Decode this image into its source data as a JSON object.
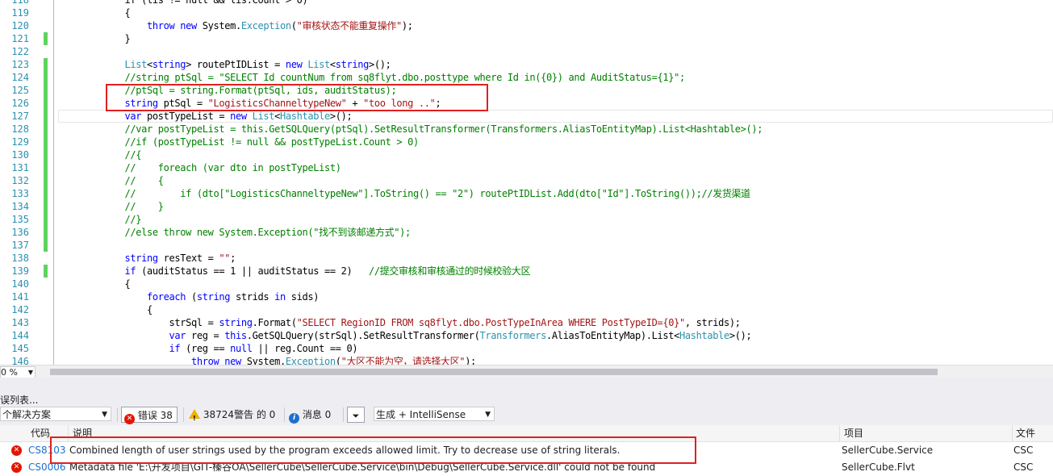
{
  "editor": {
    "lines": [
      {
        "num": "118",
        "indent": "            ",
        "tokens": [
          {
            "t": "if (lis != null && lis.Count > 0)",
            "c": ""
          }
        ]
      },
      {
        "num": "119",
        "indent": "            ",
        "tokens": [
          {
            "t": "{",
            "c": ""
          }
        ]
      },
      {
        "num": "120",
        "indent": "                ",
        "tokens": [
          {
            "t": "throw",
            "c": "kw"
          },
          {
            "t": " ",
            "c": ""
          },
          {
            "t": "new",
            "c": "kw"
          },
          {
            "t": " System.",
            "c": ""
          },
          {
            "t": "Exception",
            "c": "ty"
          },
          {
            "t": "(",
            "c": ""
          },
          {
            "t": "\"审核状态不能重复操作\"",
            "c": "st"
          },
          {
            "t": ");",
            "c": ""
          }
        ]
      },
      {
        "num": "121",
        "indent": "            ",
        "tokens": [
          {
            "t": "}",
            "c": ""
          }
        ]
      },
      {
        "num": "122",
        "indent": "",
        "tokens": []
      },
      {
        "num": "123",
        "indent": "            ",
        "tokens": [
          {
            "t": "List",
            "c": "ty"
          },
          {
            "t": "<",
            "c": ""
          },
          {
            "t": "string",
            "c": "kw"
          },
          {
            "t": "> routePtIDList = ",
            "c": ""
          },
          {
            "t": "new",
            "c": "kw"
          },
          {
            "t": " ",
            "c": ""
          },
          {
            "t": "List",
            "c": "ty"
          },
          {
            "t": "<",
            "c": ""
          },
          {
            "t": "string",
            "c": "kw"
          },
          {
            "t": ">();",
            "c": ""
          }
        ]
      },
      {
        "num": "124",
        "indent": "            ",
        "tokens": [
          {
            "t": "//string ptSql = \"SELECT Id countNum from sq8flyt.dbo.posttype where Id in({0}) and AuditStatus={1}\";",
            "c": "cm"
          }
        ]
      },
      {
        "num": "125",
        "indent": "            ",
        "tokens": [
          {
            "t": "//ptSql = string.Format(ptSql, ids, auditStatus);",
            "c": "cm"
          }
        ]
      },
      {
        "num": "126",
        "indent": "            ",
        "tokens": [
          {
            "t": "string",
            "c": "kw"
          },
          {
            "t": " ptSql = ",
            "c": ""
          },
          {
            "t": "\"LogisticsChanneltypeNew\"",
            "c": "st"
          },
          {
            "t": " + ",
            "c": ""
          },
          {
            "t": "\"too long ..\"",
            "c": "st"
          },
          {
            "t": ";",
            "c": ""
          }
        ]
      },
      {
        "num": "127",
        "indent": "            ",
        "tokens": [
          {
            "t": "var",
            "c": "kw"
          },
          {
            "t": " postTypeList = ",
            "c": ""
          },
          {
            "t": "new",
            "c": "kw"
          },
          {
            "t": " ",
            "c": ""
          },
          {
            "t": "List",
            "c": "ty"
          },
          {
            "t": "<",
            "c": ""
          },
          {
            "t": "Hashtable",
            "c": "ty"
          },
          {
            "t": ">();",
            "c": ""
          }
        ]
      },
      {
        "num": "128",
        "indent": "            ",
        "tokens": [
          {
            "t": "//var postTypeList = this.GetSQLQuery(ptSql).SetResultTransformer(Transformers.AliasToEntityMap).List<Hashtable>();",
            "c": "cm"
          }
        ]
      },
      {
        "num": "129",
        "indent": "            ",
        "tokens": [
          {
            "t": "//if (postTypeList != null && postTypeList.Count > 0)",
            "c": "cm"
          }
        ]
      },
      {
        "num": "130",
        "indent": "            ",
        "tokens": [
          {
            "t": "//{",
            "c": "cm"
          }
        ]
      },
      {
        "num": "131",
        "indent": "            ",
        "tokens": [
          {
            "t": "//    foreach (var dto in postTypeList)",
            "c": "cm"
          }
        ]
      },
      {
        "num": "132",
        "indent": "            ",
        "tokens": [
          {
            "t": "//    {",
            "c": "cm"
          }
        ]
      },
      {
        "num": "133",
        "indent": "            ",
        "tokens": [
          {
            "t": "//        if (dto[\"LogisticsChanneltypeNew\"].ToString() == \"2\") routePtIDList.Add(dto[\"Id\"].ToString());//发货渠道",
            "c": "cm"
          }
        ]
      },
      {
        "num": "134",
        "indent": "            ",
        "tokens": [
          {
            "t": "//    }",
            "c": "cm"
          }
        ]
      },
      {
        "num": "135",
        "indent": "            ",
        "tokens": [
          {
            "t": "//}",
            "c": "cm"
          }
        ]
      },
      {
        "num": "136",
        "indent": "            ",
        "tokens": [
          {
            "t": "//else throw new System.Exception(\"找不到该邮递方式\");",
            "c": "cm"
          }
        ]
      },
      {
        "num": "137",
        "indent": "",
        "tokens": []
      },
      {
        "num": "138",
        "indent": "            ",
        "tokens": [
          {
            "t": "string",
            "c": "kw"
          },
          {
            "t": " resText = ",
            "c": ""
          },
          {
            "t": "\"\"",
            "c": "st"
          },
          {
            "t": ";",
            "c": ""
          }
        ]
      },
      {
        "num": "139",
        "indent": "            ",
        "tokens": [
          {
            "t": "if",
            "c": "kw"
          },
          {
            "t": " (auditStatus == 1 || auditStatus == 2)   ",
            "c": ""
          },
          {
            "t": "//提交审核和审核通过的时候校验大区",
            "c": "cm"
          }
        ]
      },
      {
        "num": "140",
        "indent": "            ",
        "tokens": [
          {
            "t": "{",
            "c": ""
          }
        ]
      },
      {
        "num": "141",
        "indent": "                ",
        "tokens": [
          {
            "t": "foreach",
            "c": "kw"
          },
          {
            "t": " (",
            "c": ""
          },
          {
            "t": "string",
            "c": "kw"
          },
          {
            "t": " strids ",
            "c": ""
          },
          {
            "t": "in",
            "c": "kw"
          },
          {
            "t": " sids)",
            "c": ""
          }
        ]
      },
      {
        "num": "142",
        "indent": "                ",
        "tokens": [
          {
            "t": "{",
            "c": ""
          }
        ]
      },
      {
        "num": "143",
        "indent": "                    ",
        "tokens": [
          {
            "t": "strSql = ",
            "c": ""
          },
          {
            "t": "string",
            "c": "kw"
          },
          {
            "t": ".Format(",
            "c": ""
          },
          {
            "t": "\"SELECT RegionID FROM sq8flyt.dbo.PostTypeInArea WHERE PostTypeID={0}\"",
            "c": "st"
          },
          {
            "t": ", strids);",
            "c": ""
          }
        ]
      },
      {
        "num": "144",
        "indent": "                    ",
        "tokens": [
          {
            "t": "var",
            "c": "kw"
          },
          {
            "t": " reg = ",
            "c": ""
          },
          {
            "t": "this",
            "c": "kw"
          },
          {
            "t": ".GetSQLQuery(strSql).SetResultTransformer(",
            "c": ""
          },
          {
            "t": "Transformers",
            "c": "ty"
          },
          {
            "t": ".AliasToEntityMap).List<",
            "c": ""
          },
          {
            "t": "Hashtable",
            "c": "ty"
          },
          {
            "t": ">();",
            "c": ""
          }
        ]
      },
      {
        "num": "145",
        "indent": "                    ",
        "tokens": [
          {
            "t": "if",
            "c": "kw"
          },
          {
            "t": " (reg == ",
            "c": ""
          },
          {
            "t": "null",
            "c": "kw"
          },
          {
            "t": " || reg.Count == 0)",
            "c": ""
          }
        ]
      },
      {
        "num": "146",
        "indent": "                        ",
        "tokens": [
          {
            "t": "throw",
            "c": "kw"
          },
          {
            "t": " ",
            "c": ""
          },
          {
            "t": "new",
            "c": "kw"
          },
          {
            "t": " System.",
            "c": ""
          },
          {
            "t": "Exception",
            "c": "ty"
          },
          {
            "t": "(",
            "c": ""
          },
          {
            "t": "\"大区不能为空，请选择大区\"",
            "c": "st"
          },
          {
            "t": ");",
            "c": ""
          }
        ]
      }
    ]
  },
  "statusbar": {
    "zoom": "0 %"
  },
  "errorlist": {
    "title": "误列表...",
    "scope": "个解决方案",
    "errors_label": "错误 38",
    "warnings_label": "38724警告 的 0",
    "messages_label": "消息 0",
    "build_filter": "生成 + IntelliSense",
    "columns": {
      "code": "代码",
      "desc": "说明",
      "project": "项目",
      "file": "文件"
    },
    "rows": [
      {
        "code": "CS8103",
        "desc": "Combined length of user strings used by the program exceeds allowed limit. Try to decrease use of string literals.",
        "project": "SellerCube.Service",
        "file": "CSC"
      },
      {
        "code": "CS0006",
        "desc": "Metadata file 'E:\\开发项目\\GIT-榛谷OA\\SellerCube\\SellerCube.Service\\bin\\Debug\\SellerCube.Service.dll' could not be found",
        "project": "SellerCube.Flvt",
        "file": "CSC"
      }
    ]
  },
  "colors": {
    "keyword": "#0000ff",
    "type": "#2b91af",
    "string": "#a31515",
    "comment": "#008000",
    "highlight": "#e02020"
  }
}
